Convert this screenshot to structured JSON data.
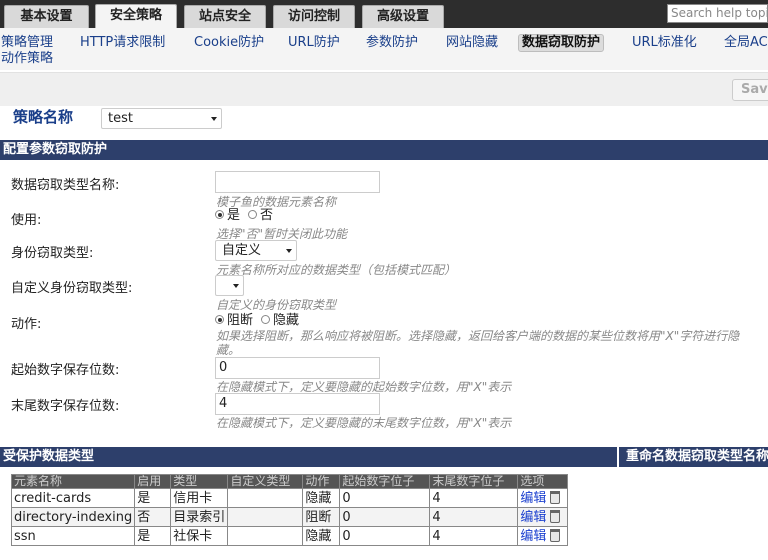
{
  "top_tabs": [
    {
      "label": "基本设置",
      "active": false
    },
    {
      "label": "安全策略",
      "active": true
    },
    {
      "label": "站点安全",
      "active": false
    },
    {
      "label": "访问控制",
      "active": false
    },
    {
      "label": "高级设置",
      "active": false
    }
  ],
  "search": {
    "placeholder": "Search help topic"
  },
  "subnav": {
    "items": [
      "策略管理",
      "HTTP请求限制",
      "Cookie防护",
      "URL防护",
      "参数防护",
      "网站隐藏",
      "数据窃取防护",
      "URL标准化",
      "全局ACL"
    ],
    "active": "数据窃取防护",
    "second_row": "动作策略"
  },
  "toolbar": {
    "save_label": "Save"
  },
  "policy": {
    "label": "策略名称",
    "value": "test"
  },
  "section_config": {
    "title": "配置参数窃取防护"
  },
  "form": {
    "type_name": {
      "label": "数据窃取类型名称:",
      "value": "",
      "hint": "模子鱼的数据元素名称"
    },
    "enable": {
      "label": "使用:",
      "options": [
        "是",
        "否"
      ],
      "selected": "是",
      "hint": "选择\"否\"暂时关闭此功能"
    },
    "id_type": {
      "label": "身份窃取类型:",
      "value": "自定义",
      "hint": "元素名称所对应的数据类型（包括模式匹配）"
    },
    "custom_id_type": {
      "label": "自定义身份窃取类型:",
      "value": "",
      "hint": "自定义的身份窃取类型"
    },
    "action": {
      "label": "动作:",
      "options": [
        "阻断",
        "隐藏"
      ],
      "selected": "阻断",
      "hint": "如果选择阻断，那么响应将被阻断。选择隐藏，返回给客户端的数据的某些位数将用\"X\"字符进行隐藏。"
    },
    "start_digits": {
      "label": "起始数字保存位数:",
      "value": "0",
      "hint": "在隐藏模式下，定义要隐藏的起始数字位数，用\"X\"表示"
    },
    "end_digits": {
      "label": "末尾数字保存位数:",
      "value": "4",
      "hint": "在隐藏模式下，定义要隐藏的末尾数字位数，用\"X\"表示"
    }
  },
  "section_protected": {
    "title": "受保护数据类型",
    "right_title": "重命名数据窃取类型名称"
  },
  "table": {
    "columns": [
      "元素名称",
      "启用",
      "类型",
      "自定义类型",
      "动作",
      "起始数字位子",
      "末尾数字位子",
      "选项"
    ],
    "rows": [
      {
        "name": "credit-cards",
        "enabled": "是",
        "type": "信用卡",
        "custom": "",
        "action": "隐藏",
        "start": "0",
        "end": "4",
        "edit": "编辑"
      },
      {
        "name": "directory-indexing",
        "enabled": "否",
        "type": "目录索引",
        "custom": "",
        "action": "阻断",
        "start": "0",
        "end": "4",
        "edit": "编辑"
      },
      {
        "name": "ssn",
        "enabled": "是",
        "type": "社保卡",
        "custom": "",
        "action": "隐藏",
        "start": "0",
        "end": "4",
        "edit": "编辑"
      }
    ]
  }
}
